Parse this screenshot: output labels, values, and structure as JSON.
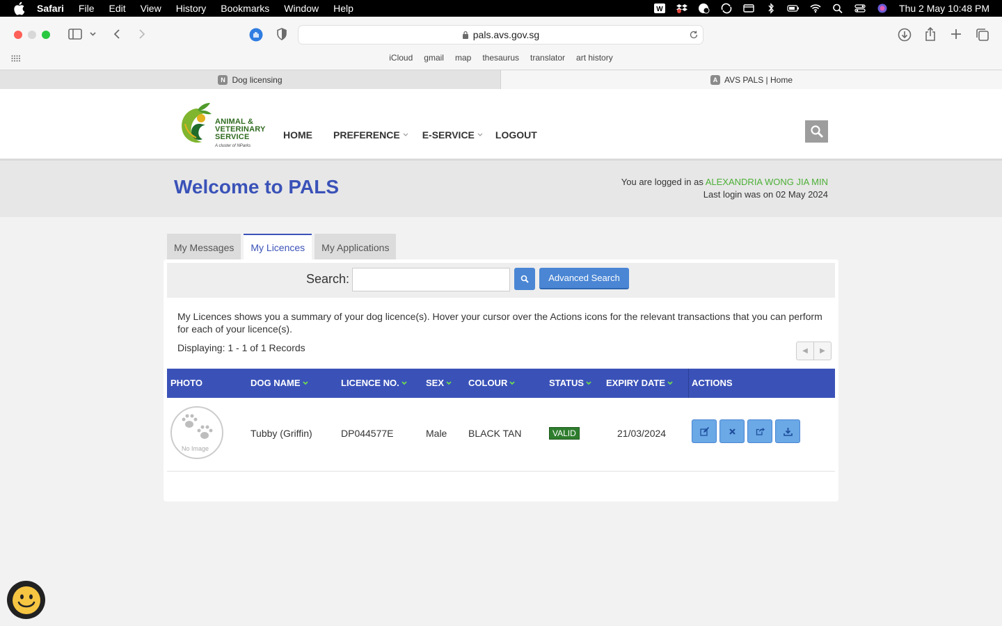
{
  "menubar": {
    "app": "Safari",
    "items": [
      "File",
      "Edit",
      "View",
      "History",
      "Bookmarks",
      "Window",
      "Help"
    ],
    "clock": "Thu 2 May  10:48 PM"
  },
  "browser": {
    "url": "pals.avs.gov.sg",
    "bookmarks": [
      "iCloud",
      "gmail",
      "map",
      "thesaurus",
      "translator",
      "art history"
    ],
    "tabs": [
      {
        "favicon": "N",
        "title": "Dog licensing"
      },
      {
        "favicon": "A",
        "title": "AVS PALS | Home"
      }
    ]
  },
  "site": {
    "logo_lines": [
      "ANIMAL &",
      "VETERINARY",
      "SERVICE"
    ],
    "logo_sub": "A cluster of NParks",
    "nav": [
      "HOME",
      "PREFERENCE",
      "E-SERVICE",
      "LOGOUT"
    ],
    "welcome": "Welcome to PALS",
    "logged_in_prefix": "You are logged in as",
    "username": "ALEXANDRIA WONG JIA MIN",
    "last_login": "Last login was on 02 May 2024"
  },
  "tabs": [
    "My Messages",
    "My Licences",
    "My Applications"
  ],
  "search": {
    "label": "Search:",
    "value": "",
    "advanced": "Advanced Search"
  },
  "content": {
    "description": "My Licences shows you a summary of your dog licence(s). Hover your cursor over the Actions icons for the relevant transactions that you can perform for each of your licence(s).",
    "displaying": "Displaying: 1 - 1 of 1 Records"
  },
  "table": {
    "headers": [
      "PHOTO",
      "DOG NAME",
      "LICENCE NO.",
      "SEX",
      "COLOUR",
      "STATUS",
      "EXPIRY DATE",
      "ACTIONS"
    ],
    "rows": [
      {
        "photo": "No Image",
        "dog_name": "Tubby (Griffin)",
        "licence_no": "DP044577E",
        "sex": "Male",
        "colour": "BLACK TAN",
        "status": "VALID",
        "expiry": "21/03/2024",
        "actions": [
          "edit-icon",
          "cancel-icon",
          "transfer-icon",
          "download-icon"
        ]
      }
    ]
  },
  "colors": {
    "brand_blue": "#3a52b8",
    "button_blue": "#4a86d4",
    "valid_green": "#2e7d2e",
    "username_green": "#4caf36"
  }
}
